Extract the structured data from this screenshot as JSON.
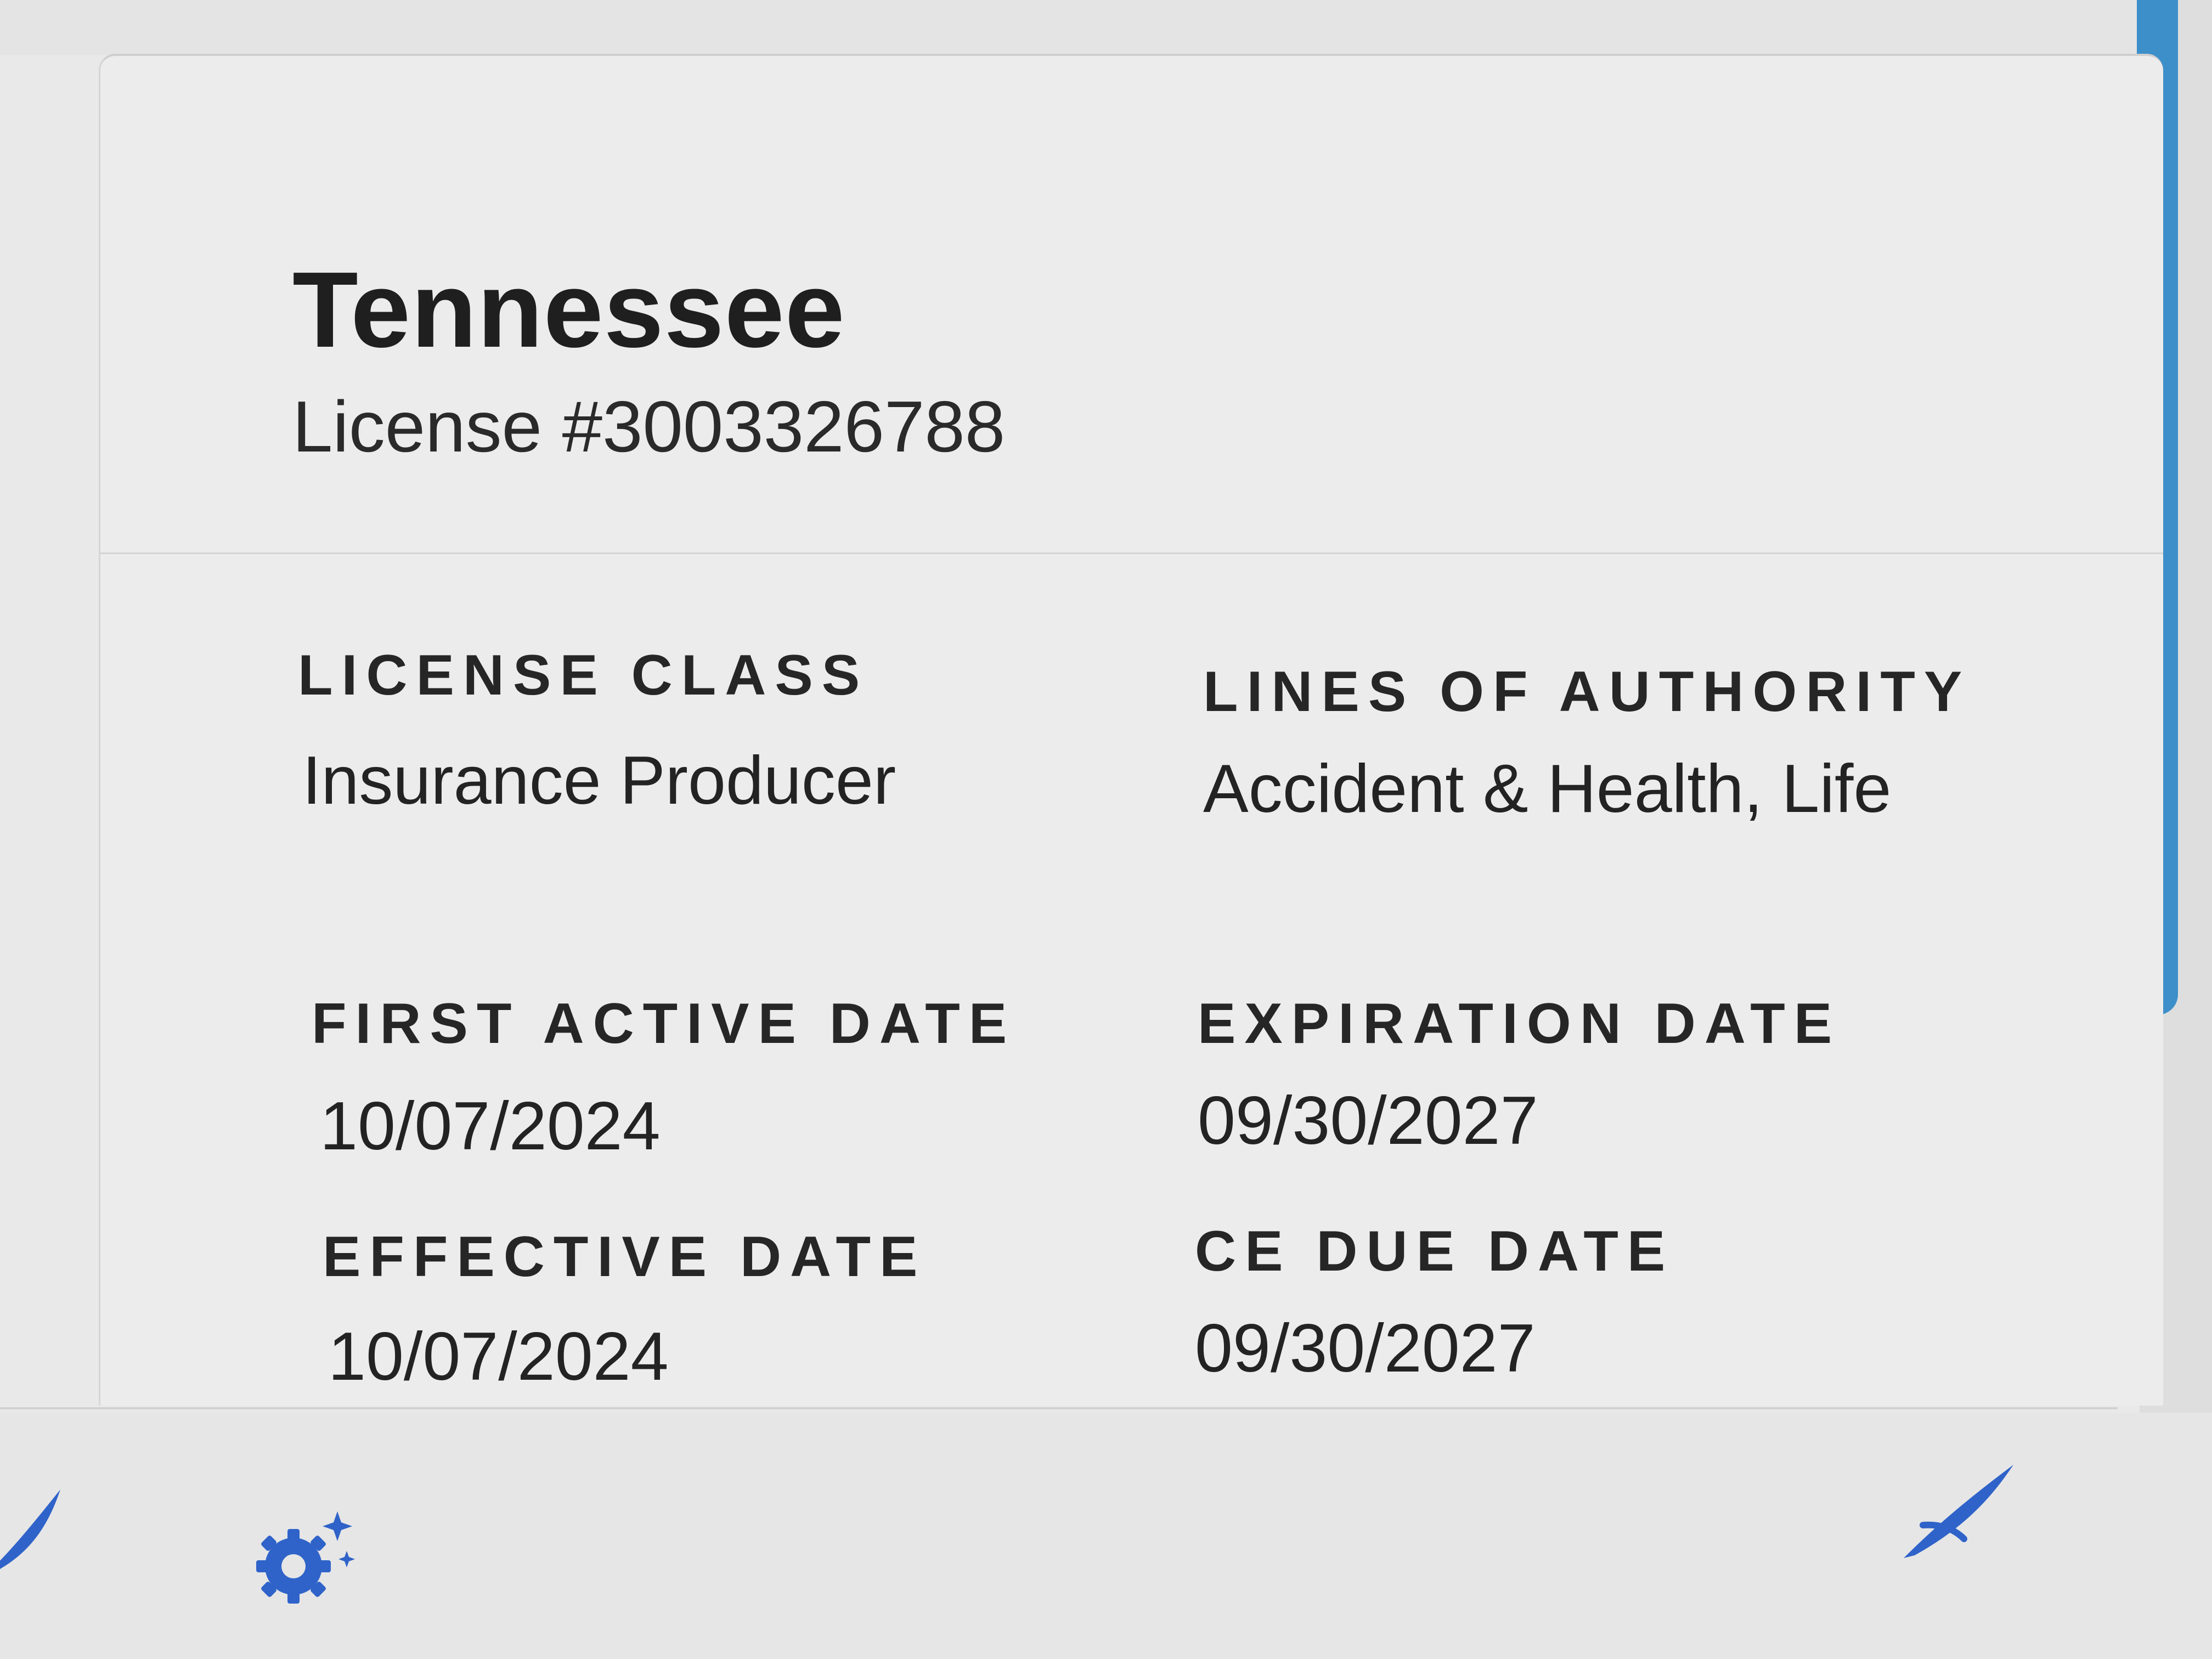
{
  "license": {
    "state": "Tennessee",
    "number_text": "License #3003326788"
  },
  "fields": {
    "license_class": {
      "label": "LICENSE CLASS",
      "value": "Insurance Producer"
    },
    "lines_of_authority": {
      "label": "LINES OF AUTHORITY",
      "value": "Accident & Health, Life"
    },
    "first_active_date": {
      "label": "FIRST ACTIVE DATE",
      "value": "10/07/2024"
    },
    "expiration_date": {
      "label": "EXPIRATION DATE",
      "value": "09/30/2027"
    },
    "effective_date": {
      "label": "EFFECTIVE DATE",
      "value": "10/07/2024"
    },
    "ce_due_date": {
      "label": "CE DUE DATE",
      "value": "09/30/2027"
    }
  },
  "icons": {
    "settings": "gear-sparkle-icon",
    "action": "swoosh-icon",
    "accent_color": "#2f63c9"
  },
  "colors": {
    "scrollbar": "#3d8fca"
  }
}
